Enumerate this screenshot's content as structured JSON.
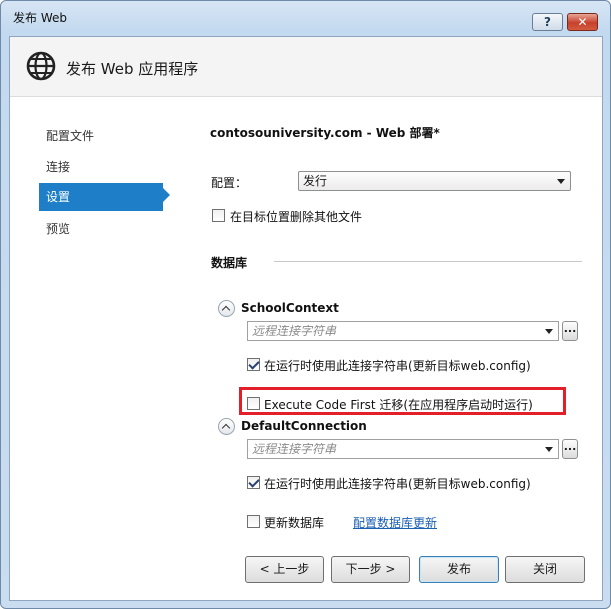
{
  "window": {
    "title": "发布 Web",
    "help_label": "?",
    "close_label": "✕"
  },
  "header": {
    "title": "发布 Web 应用程序",
    "icon": "globe-icon"
  },
  "nav": {
    "items": [
      {
        "label": "配置文件"
      },
      {
        "label": "连接"
      },
      {
        "label": "设置",
        "active": true
      },
      {
        "label": "预览"
      }
    ]
  },
  "settings": {
    "profile_title": "contosouniversity.com - Web 部署*",
    "config_label": "配置：",
    "config_value": "发行",
    "remove_files_label": "在目标位置删除其他文件",
    "remove_files_checked": false,
    "database_heading": "数据库"
  },
  "databases": [
    {
      "name": "SchoolContext",
      "connection_placeholder": "远程连接字符串",
      "ellipsis_label": "...",
      "use_at_runtime_label": "在运行时使用此连接字符串(更新目标web.config)",
      "use_at_runtime_checked": true,
      "migrations_label": "Execute Code First 迁移(在应用程序启动时运行)",
      "migrations_checked": false
    },
    {
      "name": "DefaultConnection",
      "connection_placeholder": "远程连接字符串",
      "ellipsis_label": "...",
      "use_at_runtime_label": "在运行时使用此连接字符串(更新目标web.config)",
      "use_at_runtime_checked": true,
      "update_db_label": "更新数据库",
      "update_db_checked": false,
      "configure_link": "配置数据库更新"
    }
  ],
  "footer": {
    "prev_label": "< 上一步",
    "next_label": "下一步 >",
    "publish_label": "发布",
    "close_label": "关闭"
  },
  "colors": {
    "accent": "#1e7fc8",
    "highlight": "#e3202a",
    "link": "#1a5fb4"
  }
}
